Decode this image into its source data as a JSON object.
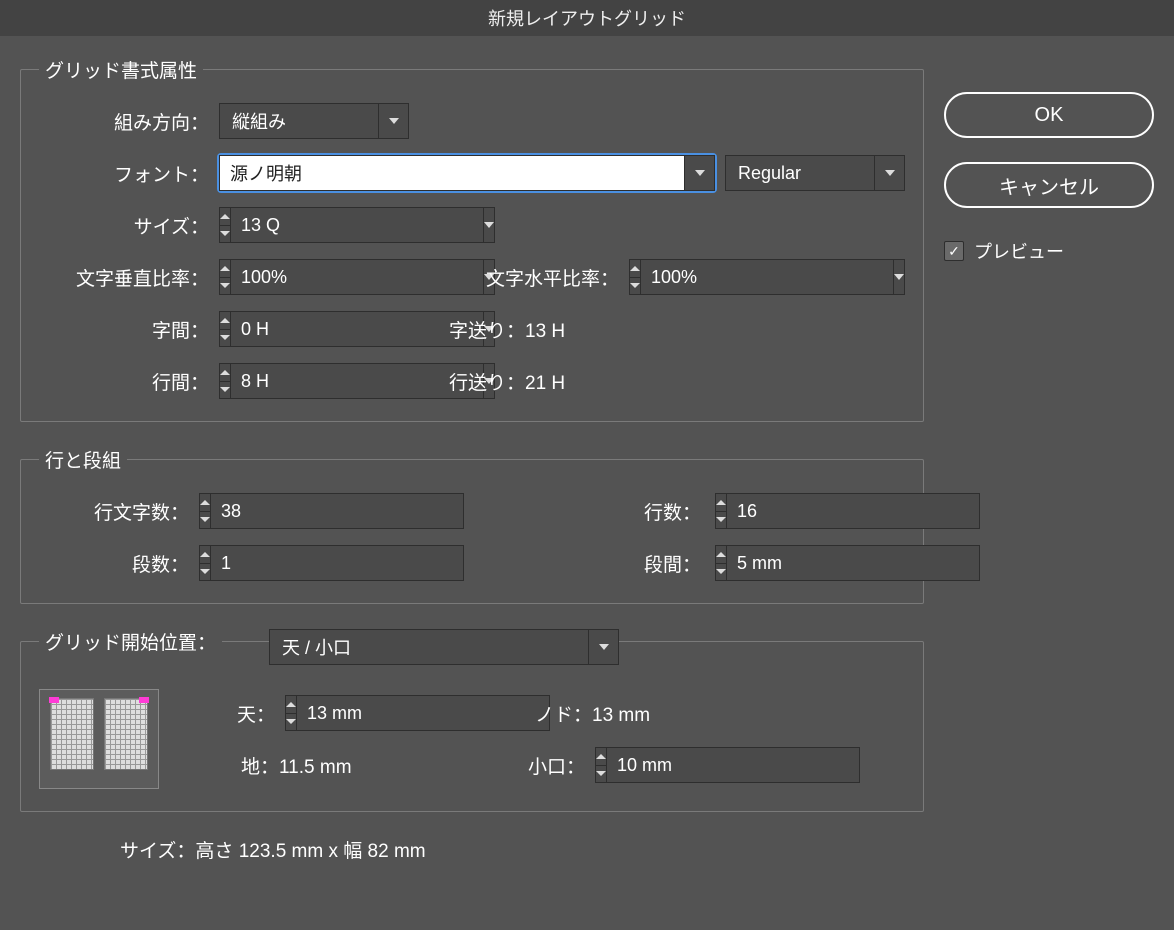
{
  "title": "新規レイアウトグリッド",
  "groups": {
    "format": {
      "legend": "グリッド書式属性",
      "direction_label": "組み方向：",
      "direction_value": "縦組み",
      "font_label": "フォント：",
      "font_family": "源ノ明朝",
      "font_weight": "Regular",
      "size_label": "サイズ：",
      "size_value": "13 Q",
      "vscale_label": "文字垂直比率：",
      "vscale_value": "100%",
      "hscale_label": "文字水平比率：",
      "hscale_value": "100%",
      "aki_label": "字間：",
      "aki_value": "0 H",
      "okuri_label": "字送り：",
      "okuri_value": "13 H",
      "gyoaki_label": "行間：",
      "gyoaki_value": "8 H",
      "gyookuri_label": "行送り：",
      "gyookuri_value": "21 H"
    },
    "lines": {
      "legend": "行と段組",
      "chars_label": "行文字数：",
      "chars_value": "38",
      "lines_label": "行数：",
      "lines_value": "16",
      "cols_label": "段数：",
      "cols_value": "1",
      "gutter_label": "段間：",
      "gutter_value": "5 mm"
    },
    "start": {
      "legend": "グリッド開始位置：",
      "origin_value": "天 / 小口",
      "ten_label": "天：",
      "ten_value": "13 mm",
      "nodo_label": "ノド：",
      "nodo_value": "13 mm",
      "ji_label": "地：",
      "ji_value": "11.5 mm",
      "koguchi_label": "小口：",
      "koguchi_value": "10 mm"
    }
  },
  "footer": "サイズ：高さ 123.5 mm x 幅 82 mm",
  "buttons": {
    "ok": "OK",
    "cancel": "キャンセル"
  },
  "preview": {
    "label": "プレビュー",
    "checked": true
  }
}
